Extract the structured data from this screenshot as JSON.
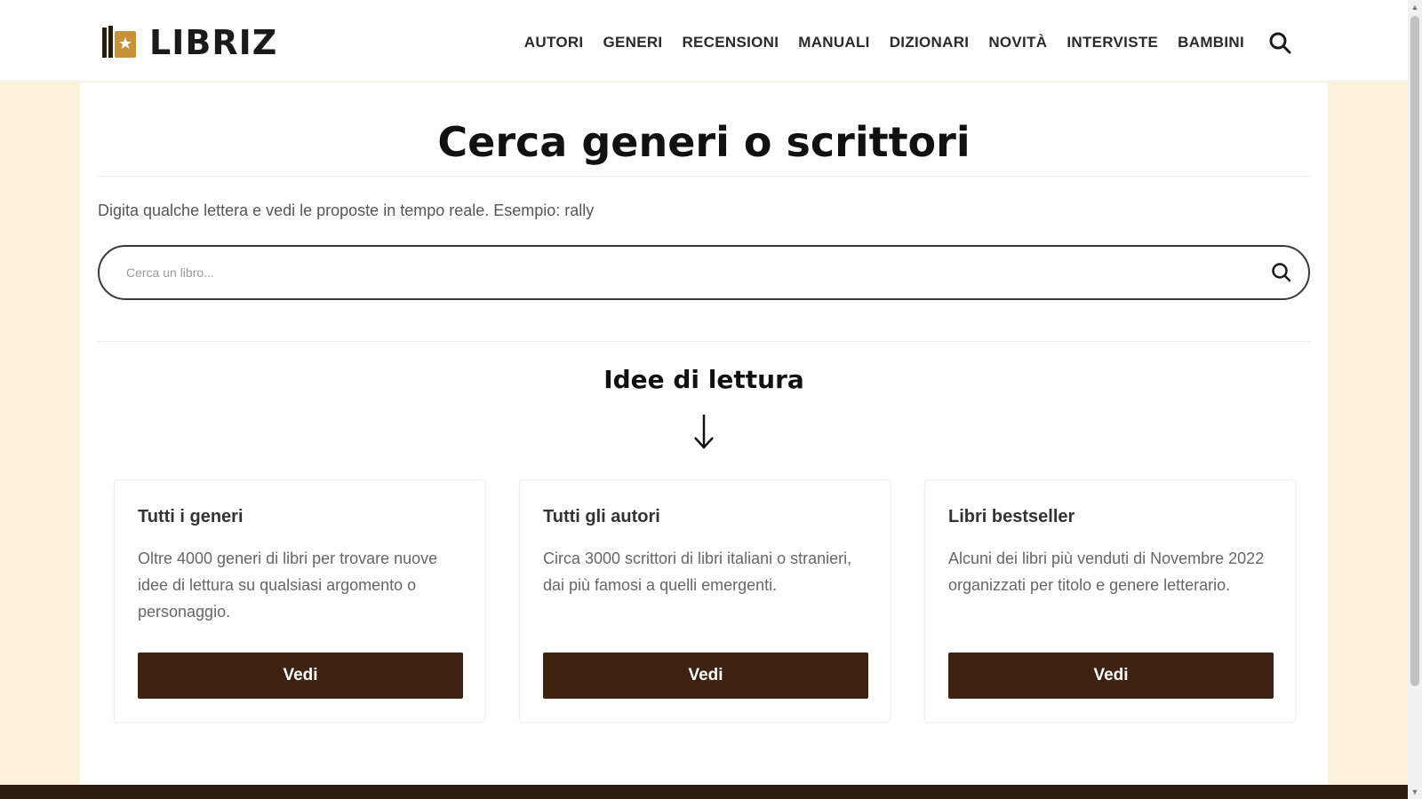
{
  "site": {
    "logo_text": "LIBRIZ",
    "brand_color": "#3e2212",
    "accent_color": "#c8913c"
  },
  "nav": {
    "items": [
      {
        "label": "AUTORI"
      },
      {
        "label": "GENERI"
      },
      {
        "label": "RECENSIONI"
      },
      {
        "label": "MANUALI"
      },
      {
        "label": "DIZIONARI"
      },
      {
        "label": "NOVITÀ"
      },
      {
        "label": "INTERVISTE"
      },
      {
        "label": "BAMBINI"
      }
    ],
    "search_icon": "search-icon"
  },
  "main": {
    "title": "Cerca generi o scrittori",
    "hint": "Digita qualche lettera e vedi le proposte in tempo reale. Esempio: rally",
    "search": {
      "placeholder": "Cerca un libro...",
      "value": "",
      "icon": "search-icon"
    },
    "section_title": "Idee di lettura",
    "arrow_icon": "arrow-down-icon",
    "cards": [
      {
        "title": "Tutti i generi",
        "description": "Oltre 4000 generi di libri per trovare nuove idee di lettura su qualsiasi argomento o personaggio.",
        "button": "Vedi"
      },
      {
        "title": "Tutti gli autori",
        "description": "Circa 3000 scrittori di libri italiani o stranieri, dai più famosi a quelli emergenti.",
        "button": "Vedi"
      },
      {
        "title": "Libri bestseller",
        "description": "Alcuni dei libri più venduti di Novembre 2022 organizzati per titolo e genere letterario.",
        "button": "Vedi"
      }
    ]
  }
}
